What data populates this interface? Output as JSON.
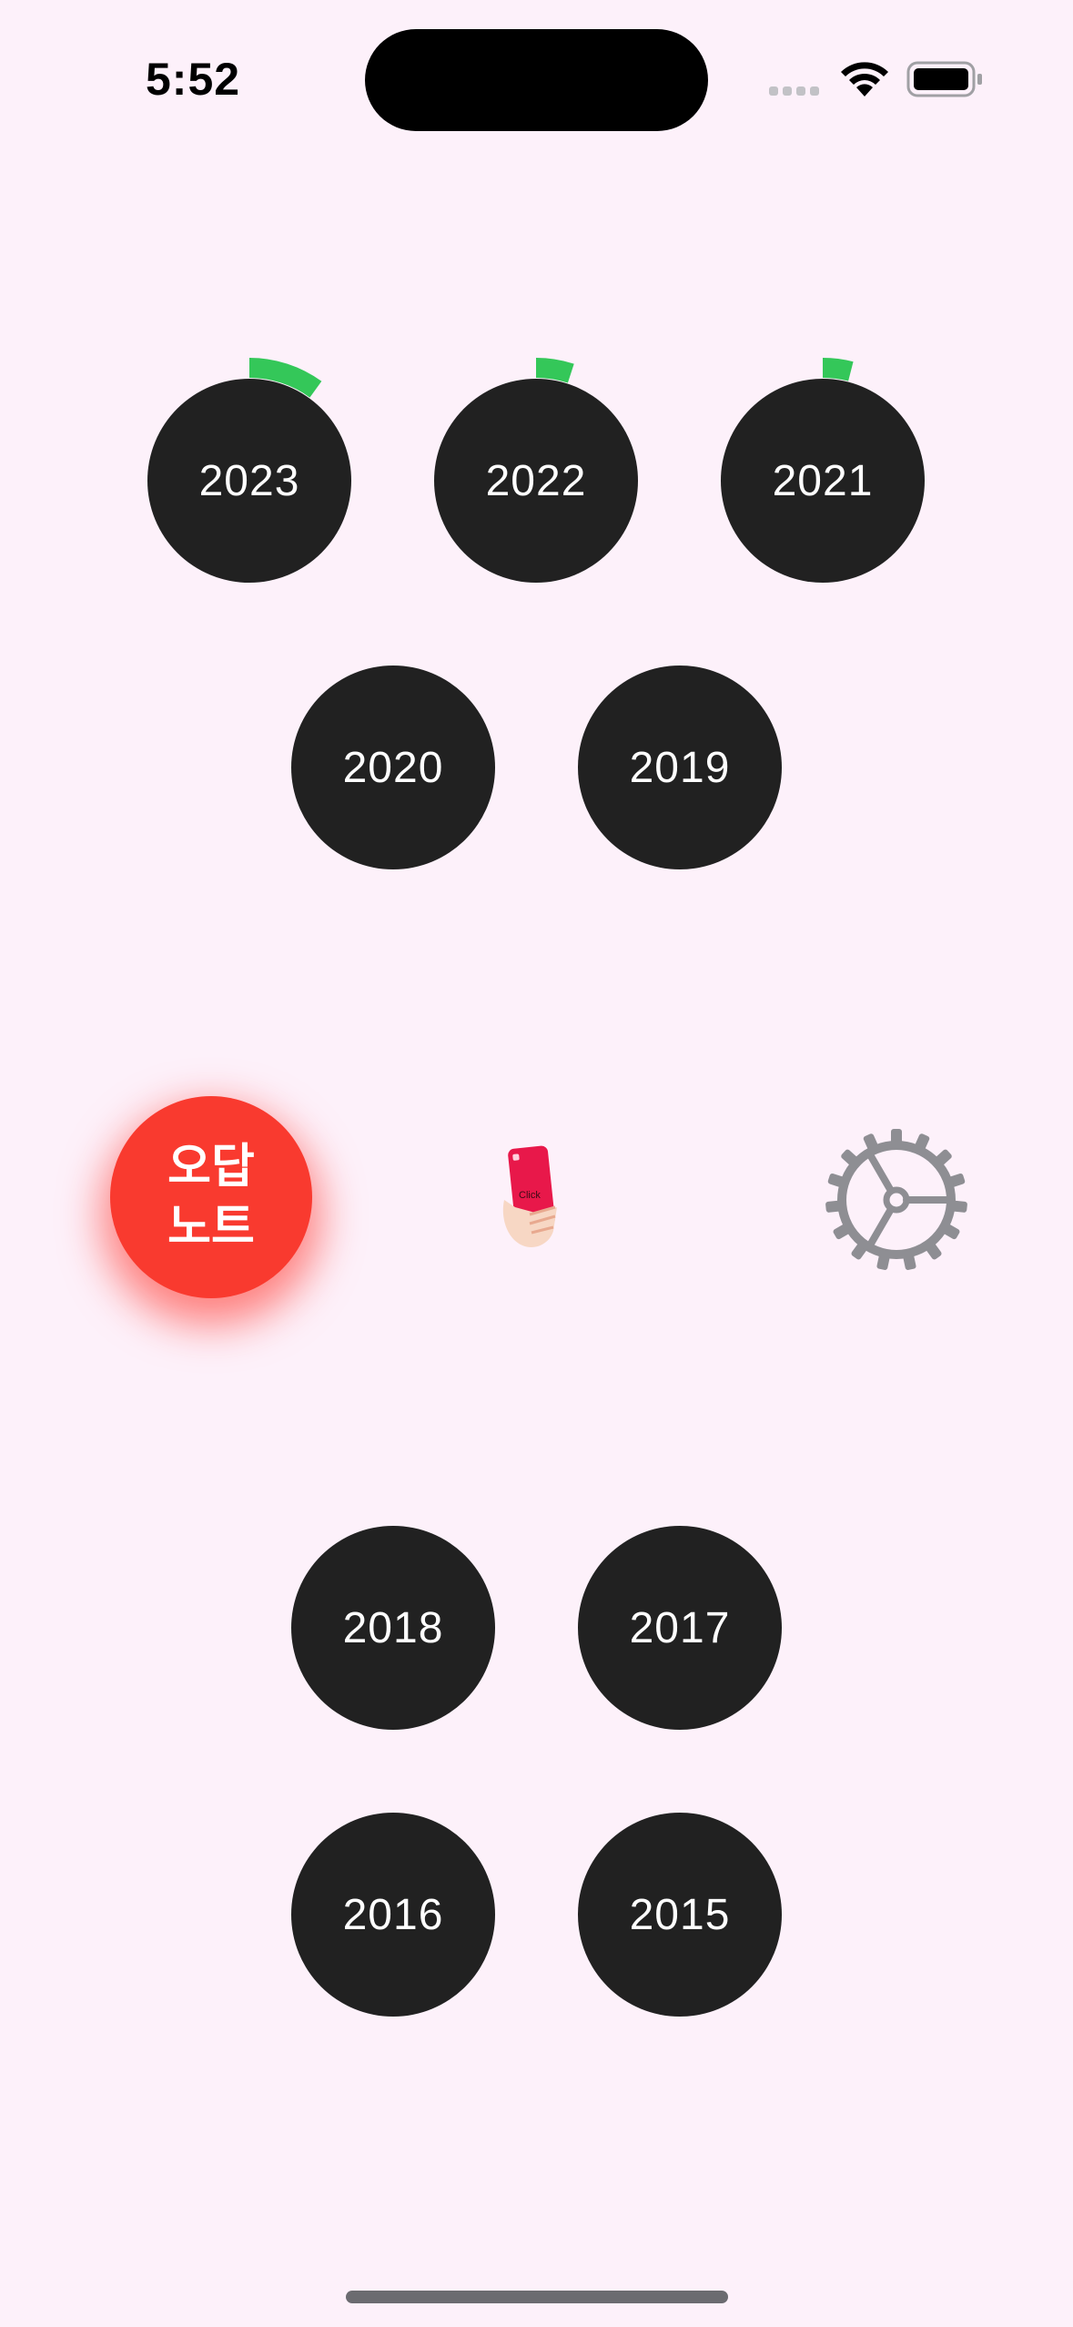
{
  "status_bar": {
    "time": "5:52"
  },
  "years_top": [
    {
      "label": "2023",
      "progress": 0.1
    },
    {
      "label": "2022",
      "progress": 0.05
    },
    {
      "label": "2021",
      "progress": 0.04
    }
  ],
  "years_middle": [
    {
      "label": "2020"
    },
    {
      "label": "2019"
    }
  ],
  "wrong_note": {
    "label": "오답\n노트",
    "color": "#f93a2f"
  },
  "tutorial_icon": {
    "name": "phone-tap-icon",
    "text": "Click"
  },
  "settings_icon": {
    "name": "gear-icon"
  },
  "years_bottom": [
    {
      "label": "2018"
    },
    {
      "label": "2017"
    },
    {
      "label": "2016"
    },
    {
      "label": "2015"
    }
  ],
  "colors": {
    "background": "#fdf1fa",
    "year_button": "#212121",
    "progress": "#34c759",
    "gear": "#8e8e93"
  }
}
